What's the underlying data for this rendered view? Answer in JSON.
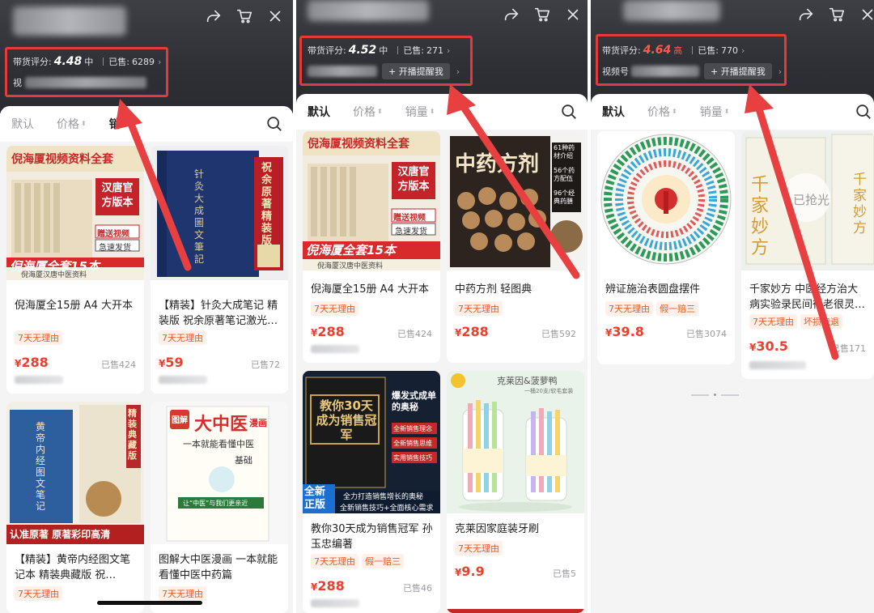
{
  "panels": [
    {
      "rating_label": "带货评分:",
      "rating_score": "4.48",
      "rating_level": "中",
      "sold_label": "已售:",
      "sold_value": "6289",
      "second_row_prefix": "视",
      "sort_tabs": [
        "默认",
        "价格",
        "销"
      ],
      "products": [
        {
          "title": "倪海厦全15册 A4 大开本",
          "tags": [
            "7天无理由"
          ],
          "price": "288",
          "sold": "已售424",
          "image": "book-set-cover"
        },
        {
          "title": "【精装】针灸大成笔记 精装版 祝余原著笔记激光…",
          "tags": [
            "7天无理由"
          ],
          "price": "59",
          "sold": "已售72",
          "image": "blue-hardcover-book"
        },
        {
          "title": "【精装】黄帝内经图文笔记本 精装典藏版 祝…",
          "tags": [
            "7天无理由"
          ],
          "price": "",
          "sold": "",
          "image": "huangdi-neijing-book"
        },
        {
          "title": "图解大中医漫画 一本就能看懂中医中药篇",
          "tags": [
            "7天无理由"
          ],
          "price": "",
          "sold": "",
          "image": "tcm-comic-book"
        }
      ]
    },
    {
      "rating_label": "带货评分:",
      "rating_score": "4.52",
      "rating_level": "中",
      "sold_label": "已售:",
      "sold_value": "271",
      "remind_label": "+ 开播提醒我",
      "sort_tabs": [
        "默认",
        "价格",
        "销量"
      ],
      "products": [
        {
          "title": "倪海厦全15册 A4 大开本",
          "tags": [
            "7天无理由"
          ],
          "price": "288",
          "sold": "已售424",
          "image": "book-set-cover"
        },
        {
          "title": "中药方剂 轻图典",
          "tags": [
            "7天无理由"
          ],
          "price": "288",
          "sold": "已售592",
          "image": "herbal-formula-book"
        },
        {
          "title": "教你30天成为销售冠军 孙玉忠编著",
          "tags": [
            "7天无理由",
            "假一赔三"
          ],
          "price": "288",
          "sold": "已售46",
          "image": "sales-champion-book"
        },
        {
          "title": "克莱因家庭装牙刷",
          "tags": [
            "7天无理由"
          ],
          "price": "9.9",
          "sold": "已售5",
          "image": "toothbrush-jar"
        }
      ]
    },
    {
      "rating_label": "带货评分:",
      "rating_score": "4.64",
      "rating_level": "高",
      "sold_label": "已售:",
      "sold_value": "770",
      "second_row_prefix": "视频号",
      "remind_label": "+ 开播提醒我",
      "sort_tabs": [
        "默认",
        "价格",
        "销量"
      ],
      "products": [
        {
          "title": "辨证施治表圆盘摆件",
          "tags": [
            "7天无理由",
            "假一赔三"
          ],
          "price": "39.8",
          "sold": "已售3074",
          "image": "circular-chart-wheel"
        },
        {
          "title": "千家妙方 中医经方治大病实验录民间很老很灵…",
          "tags": [
            "7天无理由",
            "坏损包退"
          ],
          "price": "30.5",
          "sold": "已售171",
          "image": "qianjia-miaofang-book"
        }
      ]
    }
  ],
  "book_texts": {
    "nihaixia_banner": "倪海厦视频资料全套",
    "nihaixia_badge": "汉唐官方版本",
    "nihaixia_gift": "赠送视频",
    "nihaixia_ship": "急速发货",
    "nihaixia_bottom": "倪海厦全套15本",
    "nihaixia_footer": "倪海厦汉唐中医资料",
    "zhenjiu_title": "针灸大成圖文筆記",
    "zhenjiu_ribbon": "祝余原著精装版",
    "huangdi_ribbon": "精装典藏版",
    "huangdi_title": "黄帝内经图文笔记",
    "huangdi_banner": "认准原著 原著彩印高清",
    "comic_badge": "图解",
    "comic_title": "大中医",
    "comic_sub": "漫画",
    "comic_slogan": "一本就能看懂中医",
    "comic_basic": "基础",
    "comic_quote": "让“中医”与我们更亲近",
    "herb_title": "中药方剂",
    "herb_info1": "61种药材介绍",
    "herb_info2": "56个药方配伍",
    "herb_info3": "96个经典药膳",
    "sales_title": "教你30天成为销售冠军",
    "sales_side": "爆发式成单的奥秘",
    "sales_b1": "全新销售理念",
    "sales_b2": "全新销售思维",
    "sales_b3": "实用销售技巧",
    "sales_new": "全新正版",
    "sales_strip1": "全力打造销售增长的奥秘",
    "sales_strip2": "全新销售技巧+全面核心需求",
    "brush_brand": "克莱因&菠萝鸭",
    "brush_note": "一桶20支/软毛套装",
    "qianjia_title": "千家妙方",
    "qianjia_sub": "已抢光"
  },
  "colors": {
    "accent": "#f03d2c",
    "annotation_red": "#e33b3b",
    "header_dark": "#2f3036"
  }
}
